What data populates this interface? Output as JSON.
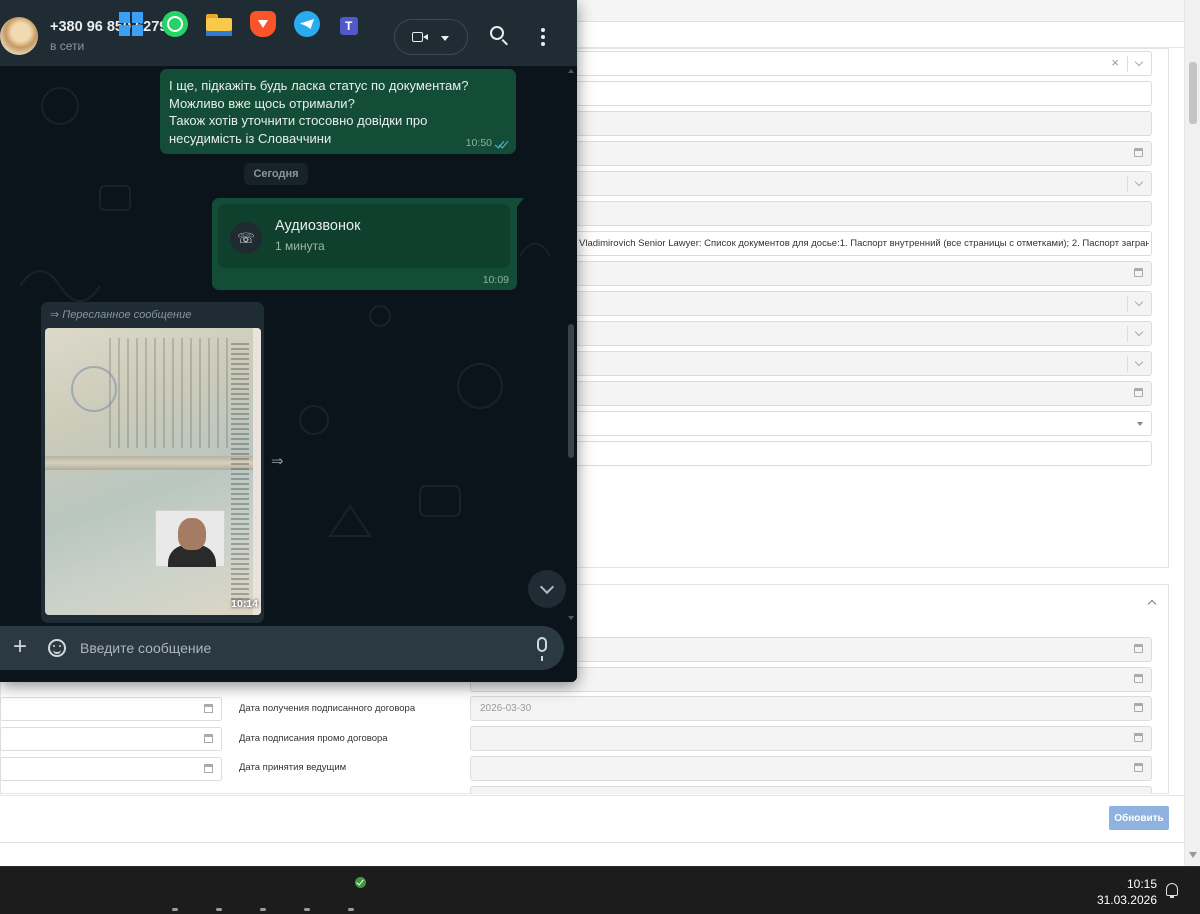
{
  "whatsapp": {
    "contact": {
      "name": "+380 96 850 6279",
      "status": "в сети"
    },
    "messages": [
      {
        "type": "text",
        "direction": "outgoing",
        "text": "І ще, підкажіть будь ласка статус по документам?\nМожливо вже щось отримали?\nТакож хотів уточнити стосовно довідки про\nнесудимість із Словаччини",
        "time": "10:50",
        "read": true
      },
      {
        "type": "date",
        "label": "Сегодня"
      },
      {
        "type": "call",
        "direction": "outgoing",
        "title": "Аудиозвонок",
        "duration": "1 минута",
        "time": "10:09"
      },
      {
        "type": "image",
        "direction": "incoming",
        "forwarded_label": "Пересланное сообщение",
        "time": "10:14"
      }
    ],
    "composer": {
      "placeholder": "Введите сообщение"
    },
    "icons": {
      "video": "video-camera-icon",
      "search": "search-icon",
      "menu": "kebab-menu-icon",
      "attach": "plus-icon",
      "sticker": "sticker-icon",
      "mic": "microphone-icon",
      "forward": "forward-icon",
      "scroll_down": "chevron-down-icon",
      "call": "phone-outgoing-icon"
    }
  },
  "crm": {
    "note_text": "Vladimirovich Senior Lawyer: Список документов для досье:1. Паспорт внутренний (все страницы с отметками);  2. Паспорт заграничный (разво",
    "labels": {
      "signed_contract_received": "Дата получения подписанного договора",
      "promo_contract_signed": "Дата подписания промо договора",
      "accepted_by_lead": "Дата принятия ведущим"
    },
    "signed_contract_date": "2026-03-30",
    "update_button": "Обновить"
  },
  "taskbar": {
    "apps": [
      "start",
      "whatsapp",
      "file-explorer",
      "brave",
      "telegram",
      "teams"
    ],
    "time": "10:15",
    "date": "31.03.2026"
  },
  "colors": {
    "wa_bubble_out": "#144d37",
    "wa_header": "#202c33",
    "wa_background": "#0b141a",
    "read_ticks": "#53bdeb",
    "update_button": "#8fb2e0"
  }
}
